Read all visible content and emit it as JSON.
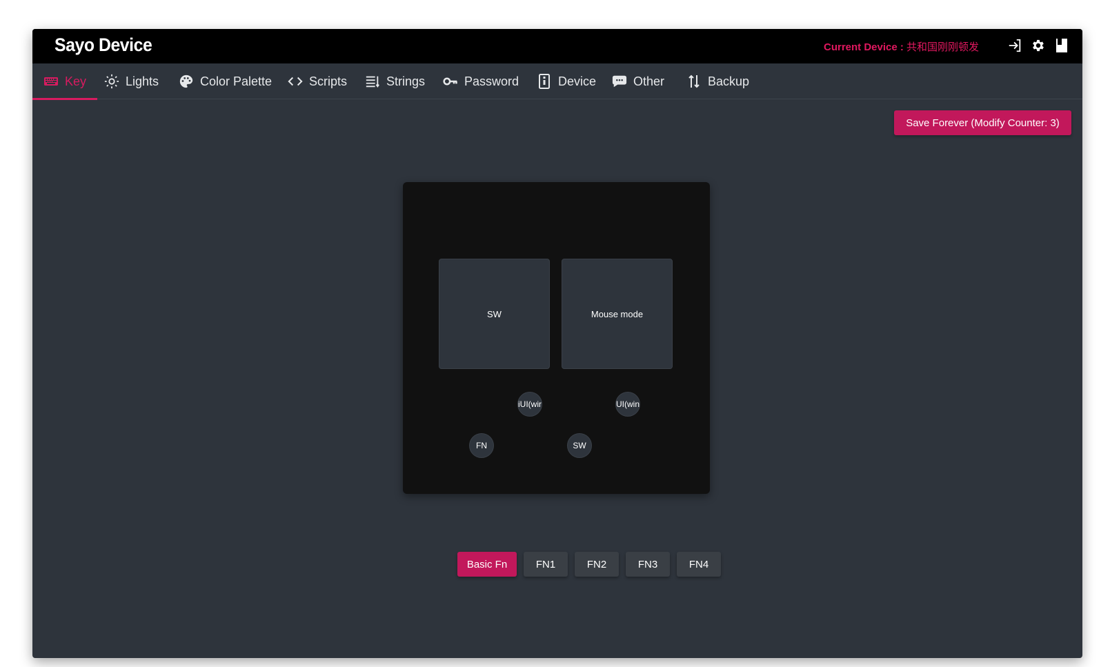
{
  "app": {
    "title": "Sayo Device"
  },
  "header": {
    "current_device_label": "Current Device :",
    "current_device_name": "共和国刚刚顿发",
    "icons": [
      "login-icon",
      "gear-icon",
      "bookmark-icon"
    ]
  },
  "nav": {
    "tabs": [
      {
        "label": "Key",
        "icon": "keyboard-icon",
        "active": true
      },
      {
        "label": "Lights",
        "icon": "sun-icon",
        "active": false
      },
      {
        "label": "Color Palette",
        "icon": "palette-icon",
        "active": false
      },
      {
        "label": "Scripts",
        "icon": "code-icon",
        "active": false
      },
      {
        "label": "Strings",
        "icon": "list-icon",
        "active": false
      },
      {
        "label": "Password",
        "icon": "key-icon",
        "active": false
      },
      {
        "label": "Device",
        "icon": "device-icon",
        "active": false
      },
      {
        "label": "Other",
        "icon": "chat-icon",
        "active": false
      },
      {
        "label": "Backup",
        "icon": "sort-arrows-icon",
        "active": false
      }
    ]
  },
  "toolbar": {
    "save_label": "Save Forever (Modify Counter: 3)"
  },
  "keypad": {
    "big_keys": [
      "SW",
      "Mouse mode"
    ],
    "round_keys": [
      "iUI(wir",
      "UI(win",
      "FN",
      "SW"
    ]
  },
  "layers": {
    "tabs": [
      "Basic Fn",
      "FN1",
      "FN2",
      "FN3",
      "FN4"
    ],
    "selected": "Basic Fn"
  },
  "colors": {
    "accent": "#c2185b",
    "background": "#2e343c",
    "titlebar": "#000000",
    "panel": "#111111"
  }
}
